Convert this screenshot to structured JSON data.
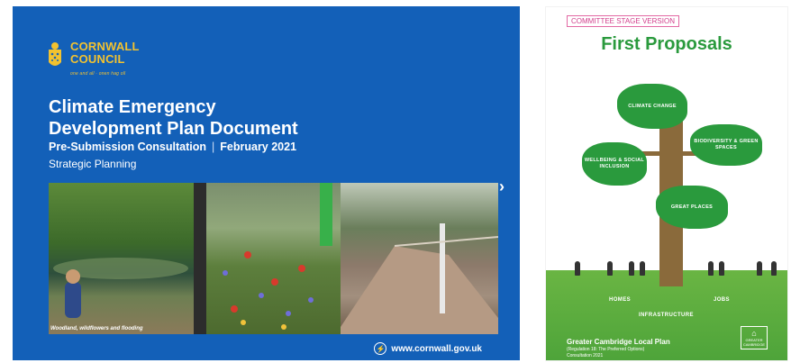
{
  "left_doc": {
    "logo_line1": "CORNWALL",
    "logo_line2": "COUNCIL",
    "logo_motto": "one and all · onen hag oll",
    "title_line1": "Climate Emergency",
    "title_line2": "Development Plan Document",
    "subtitle": "Pre-Submission Consultation",
    "subtitle_sep": "|",
    "date": "February 2021",
    "department": "Strategic Planning",
    "photo_caption": "Woodland, wildflowers and flooding",
    "website": "www.cornwall.gov.uk",
    "next_arrow": "›",
    "brand_color": "#1360b8",
    "logo_color": "#f2c230"
  },
  "right_doc": {
    "badge": "COMMITTEE STAGE VERSION",
    "title": "First Proposals",
    "clouds": {
      "climate": "CLIMATE CHANGE",
      "biodiversity": "BIODIVERSITY & GREEN SPACES",
      "wellbeing": "WELLBEING & SOCIAL INCLUSION",
      "great_places": "GREAT PLACES"
    },
    "roots": {
      "homes": "HOMES",
      "jobs": "JOBS",
      "infrastructure": "INFRASTRUCTURE"
    },
    "footer_title": "Greater Cambridge Local Plan",
    "footer_sub1": "(Regulation 18: The Preferred Options)",
    "footer_sub2": "Consultation 2021",
    "logo_text": "GREATER CAMBRIDGE",
    "title_color": "#2a9a3d",
    "badge_color": "#d13d8b"
  }
}
